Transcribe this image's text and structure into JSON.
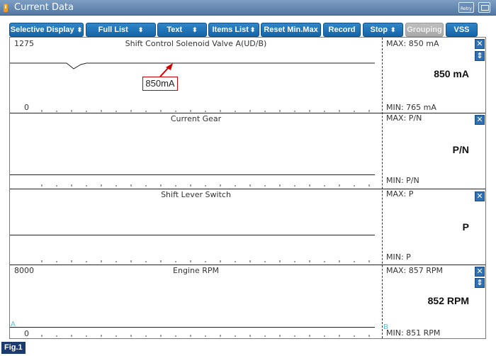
{
  "window": {
    "title": "Current Data",
    "retry_label": "Retry"
  },
  "toolbar": {
    "selective_display": "Selective Display",
    "full_list": "Full List",
    "text": "Text",
    "items_list": "Items List",
    "reset_min_max": "Reset Min.Max",
    "record": "Record",
    "stop": "Stop",
    "grouping": "Grouping",
    "vss": "VSS",
    "updown_glyph": "⬍"
  },
  "panels": [
    {
      "title": "Shift Control Solenoid Valve A(UD/B)",
      "y_max_label": "1275",
      "y_min_label": "0",
      "max_text": "MAX:   850 mA",
      "value": "850 mA",
      "min_text": "MIN:   765 mA"
    },
    {
      "title": "Current Gear",
      "max_text": "MAX: P/N",
      "value": "P/N",
      "min_text": "MIN: P/N"
    },
    {
      "title": "Shift Lever Switch",
      "max_text": "MAX: P",
      "value": "P",
      "min_text": "MIN: P"
    },
    {
      "title": "Engine RPM",
      "y_max_label": "8000",
      "y_min_label": "0",
      "max_text": "MAX:   857 RPM",
      "value": "852 RPM",
      "min_text": "MIN:   851 RPM",
      "cursor_a": "A",
      "cursor_b": "B"
    }
  ],
  "annotation": {
    "label": "850mA",
    "color": "#d00000"
  },
  "icons": {
    "close": "✕",
    "expand": "⇕"
  },
  "figure_label": "Fig.1",
  "colors": {
    "button_blue": "#1f75ba",
    "title_bar": "#6a8cb6",
    "figure_bg": "#1d3a6e"
  }
}
